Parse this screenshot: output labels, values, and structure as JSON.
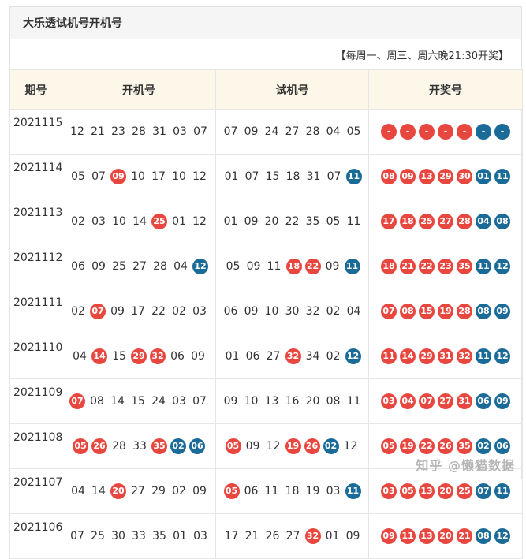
{
  "title": "大乐透试机号开机号",
  "schedule": "【每周一、周三、周六晚21:30开奖】",
  "headers": {
    "issue": "期号",
    "open": "开机号",
    "trial": "试机号",
    "draw": "开奖号"
  },
  "rows": [
    {
      "issue": "2021115",
      "open": [
        {
          "v": "12"
        },
        {
          "v": "21"
        },
        {
          "v": "23"
        },
        {
          "v": "28"
        },
        {
          "v": "31"
        },
        {
          "v": "03"
        },
        {
          "v": "07"
        }
      ],
      "trial": [
        {
          "v": "07"
        },
        {
          "v": "09"
        },
        {
          "v": "24"
        },
        {
          "v": "27"
        },
        {
          "v": "28"
        },
        {
          "v": "04"
        },
        {
          "v": "05"
        }
      ],
      "draw": [
        {
          "v": "-",
          "c": "red"
        },
        {
          "v": "-",
          "c": "red"
        },
        {
          "v": "-",
          "c": "red"
        },
        {
          "v": "-",
          "c": "red"
        },
        {
          "v": "-",
          "c": "red"
        },
        {
          "v": "-",
          "c": "blue"
        },
        {
          "v": "-",
          "c": "blue"
        }
      ]
    },
    {
      "issue": "2021114",
      "open": [
        {
          "v": "05"
        },
        {
          "v": "07"
        },
        {
          "v": "09",
          "c": "red"
        },
        {
          "v": "10"
        },
        {
          "v": "17"
        },
        {
          "v": "10"
        },
        {
          "v": "12"
        }
      ],
      "trial": [
        {
          "v": "01"
        },
        {
          "v": "07"
        },
        {
          "v": "15"
        },
        {
          "v": "18"
        },
        {
          "v": "31"
        },
        {
          "v": "07"
        },
        {
          "v": "11",
          "c": "blue"
        }
      ],
      "draw": [
        {
          "v": "08",
          "c": "red"
        },
        {
          "v": "09",
          "c": "red"
        },
        {
          "v": "13",
          "c": "red"
        },
        {
          "v": "29",
          "c": "red"
        },
        {
          "v": "30",
          "c": "red"
        },
        {
          "v": "01",
          "c": "blue"
        },
        {
          "v": "11",
          "c": "blue"
        }
      ]
    },
    {
      "issue": "2021113",
      "open": [
        {
          "v": "02"
        },
        {
          "v": "03"
        },
        {
          "v": "10"
        },
        {
          "v": "14"
        },
        {
          "v": "25",
          "c": "red"
        },
        {
          "v": "01"
        },
        {
          "v": "12"
        }
      ],
      "trial": [
        {
          "v": "01"
        },
        {
          "v": "09"
        },
        {
          "v": "20"
        },
        {
          "v": "22"
        },
        {
          "v": "35"
        },
        {
          "v": "05"
        },
        {
          "v": "11"
        }
      ],
      "draw": [
        {
          "v": "17",
          "c": "red"
        },
        {
          "v": "18",
          "c": "red"
        },
        {
          "v": "25",
          "c": "red"
        },
        {
          "v": "27",
          "c": "red"
        },
        {
          "v": "28",
          "c": "red"
        },
        {
          "v": "04",
          "c": "blue"
        },
        {
          "v": "08",
          "c": "blue"
        }
      ]
    },
    {
      "issue": "2021112",
      "open": [
        {
          "v": "06"
        },
        {
          "v": "09"
        },
        {
          "v": "25"
        },
        {
          "v": "27"
        },
        {
          "v": "28"
        },
        {
          "v": "04"
        },
        {
          "v": "12",
          "c": "blue"
        }
      ],
      "trial": [
        {
          "v": "05"
        },
        {
          "v": "09"
        },
        {
          "v": "11"
        },
        {
          "v": "18",
          "c": "red"
        },
        {
          "v": "22",
          "c": "red"
        },
        {
          "v": "09"
        },
        {
          "v": "11",
          "c": "blue"
        }
      ],
      "draw": [
        {
          "v": "18",
          "c": "red"
        },
        {
          "v": "21",
          "c": "red"
        },
        {
          "v": "22",
          "c": "red"
        },
        {
          "v": "23",
          "c": "red"
        },
        {
          "v": "35",
          "c": "red"
        },
        {
          "v": "11",
          "c": "blue"
        },
        {
          "v": "12",
          "c": "blue"
        }
      ]
    },
    {
      "issue": "2021111",
      "open": [
        {
          "v": "02"
        },
        {
          "v": "07",
          "c": "red"
        },
        {
          "v": "09"
        },
        {
          "v": "17"
        },
        {
          "v": "22"
        },
        {
          "v": "02"
        },
        {
          "v": "03"
        }
      ],
      "trial": [
        {
          "v": "06"
        },
        {
          "v": "09"
        },
        {
          "v": "10"
        },
        {
          "v": "30"
        },
        {
          "v": "32"
        },
        {
          "v": "02"
        },
        {
          "v": "04"
        }
      ],
      "draw": [
        {
          "v": "07",
          "c": "red"
        },
        {
          "v": "08",
          "c": "red"
        },
        {
          "v": "15",
          "c": "red"
        },
        {
          "v": "19",
          "c": "red"
        },
        {
          "v": "28",
          "c": "red"
        },
        {
          "v": "08",
          "c": "blue"
        },
        {
          "v": "09",
          "c": "blue"
        }
      ]
    },
    {
      "issue": "2021110",
      "open": [
        {
          "v": "04"
        },
        {
          "v": "14",
          "c": "red"
        },
        {
          "v": "15"
        },
        {
          "v": "29",
          "c": "red"
        },
        {
          "v": "32",
          "c": "red"
        },
        {
          "v": "06"
        },
        {
          "v": "09"
        }
      ],
      "trial": [
        {
          "v": "01"
        },
        {
          "v": "06"
        },
        {
          "v": "27"
        },
        {
          "v": "32",
          "c": "red"
        },
        {
          "v": "34"
        },
        {
          "v": "02"
        },
        {
          "v": "12",
          "c": "blue"
        }
      ],
      "draw": [
        {
          "v": "11",
          "c": "red"
        },
        {
          "v": "14",
          "c": "red"
        },
        {
          "v": "29",
          "c": "red"
        },
        {
          "v": "31",
          "c": "red"
        },
        {
          "v": "32",
          "c": "red"
        },
        {
          "v": "11",
          "c": "blue"
        },
        {
          "v": "12",
          "c": "blue"
        }
      ]
    },
    {
      "issue": "2021109",
      "open": [
        {
          "v": "07",
          "c": "red"
        },
        {
          "v": "08"
        },
        {
          "v": "14"
        },
        {
          "v": "15"
        },
        {
          "v": "24"
        },
        {
          "v": "03"
        },
        {
          "v": "07"
        }
      ],
      "trial": [
        {
          "v": "09"
        },
        {
          "v": "10"
        },
        {
          "v": "13"
        },
        {
          "v": "16"
        },
        {
          "v": "20"
        },
        {
          "v": "08"
        },
        {
          "v": "11"
        }
      ],
      "draw": [
        {
          "v": "03",
          "c": "red"
        },
        {
          "v": "04",
          "c": "red"
        },
        {
          "v": "07",
          "c": "red"
        },
        {
          "v": "27",
          "c": "red"
        },
        {
          "v": "31",
          "c": "red"
        },
        {
          "v": "06",
          "c": "blue"
        },
        {
          "v": "09",
          "c": "blue"
        }
      ]
    },
    {
      "issue": "2021108",
      "open": [
        {
          "v": "05",
          "c": "red"
        },
        {
          "v": "26",
          "c": "red"
        },
        {
          "v": "28"
        },
        {
          "v": "33"
        },
        {
          "v": "35",
          "c": "red"
        },
        {
          "v": "02",
          "c": "blue"
        },
        {
          "v": "06",
          "c": "blue"
        }
      ],
      "trial": [
        {
          "v": "05",
          "c": "red"
        },
        {
          "v": "09"
        },
        {
          "v": "12"
        },
        {
          "v": "19",
          "c": "red"
        },
        {
          "v": "26",
          "c": "red"
        },
        {
          "v": "02",
          "c": "blue"
        },
        {
          "v": "12"
        }
      ],
      "draw": [
        {
          "v": "05",
          "c": "red"
        },
        {
          "v": "19",
          "c": "red"
        },
        {
          "v": "22",
          "c": "red"
        },
        {
          "v": "26",
          "c": "red"
        },
        {
          "v": "35",
          "c": "red"
        },
        {
          "v": "02",
          "c": "blue"
        },
        {
          "v": "06",
          "c": "blue"
        }
      ]
    },
    {
      "issue": "2021107",
      "open": [
        {
          "v": "04"
        },
        {
          "v": "14"
        },
        {
          "v": "20",
          "c": "red"
        },
        {
          "v": "27"
        },
        {
          "v": "29"
        },
        {
          "v": "02"
        },
        {
          "v": "09"
        }
      ],
      "trial": [
        {
          "v": "05",
          "c": "red"
        },
        {
          "v": "06"
        },
        {
          "v": "11"
        },
        {
          "v": "18"
        },
        {
          "v": "19"
        },
        {
          "v": "03"
        },
        {
          "v": "11",
          "c": "blue"
        }
      ],
      "draw": [
        {
          "v": "03",
          "c": "red"
        },
        {
          "v": "05",
          "c": "red"
        },
        {
          "v": "13",
          "c": "red"
        },
        {
          "v": "20",
          "c": "red"
        },
        {
          "v": "25",
          "c": "red"
        },
        {
          "v": "07",
          "c": "blue"
        },
        {
          "v": "11",
          "c": "blue"
        }
      ]
    },
    {
      "issue": "2021106",
      "open": [
        {
          "v": "07"
        },
        {
          "v": "25"
        },
        {
          "v": "30"
        },
        {
          "v": "33"
        },
        {
          "v": "35"
        },
        {
          "v": "01"
        },
        {
          "v": "03"
        }
      ],
      "trial": [
        {
          "v": "17"
        },
        {
          "v": "21"
        },
        {
          "v": "26"
        },
        {
          "v": "27"
        },
        {
          "v": "32",
          "c": "red"
        },
        {
          "v": "01"
        },
        {
          "v": "09"
        }
      ],
      "draw": [
        {
          "v": "09",
          "c": "red"
        },
        {
          "v": "11",
          "c": "red"
        },
        {
          "v": "13",
          "c": "red"
        },
        {
          "v": "20",
          "c": "red"
        },
        {
          "v": "21",
          "c": "red"
        },
        {
          "v": "08",
          "c": "blue"
        },
        {
          "v": "12",
          "c": "blue"
        }
      ]
    }
  ],
  "watermark": "知乎 @懒猫数据",
  "colors": {
    "red": "#e8473f",
    "blue": "#1b6b98",
    "header_bg": "#fcf7e8"
  }
}
